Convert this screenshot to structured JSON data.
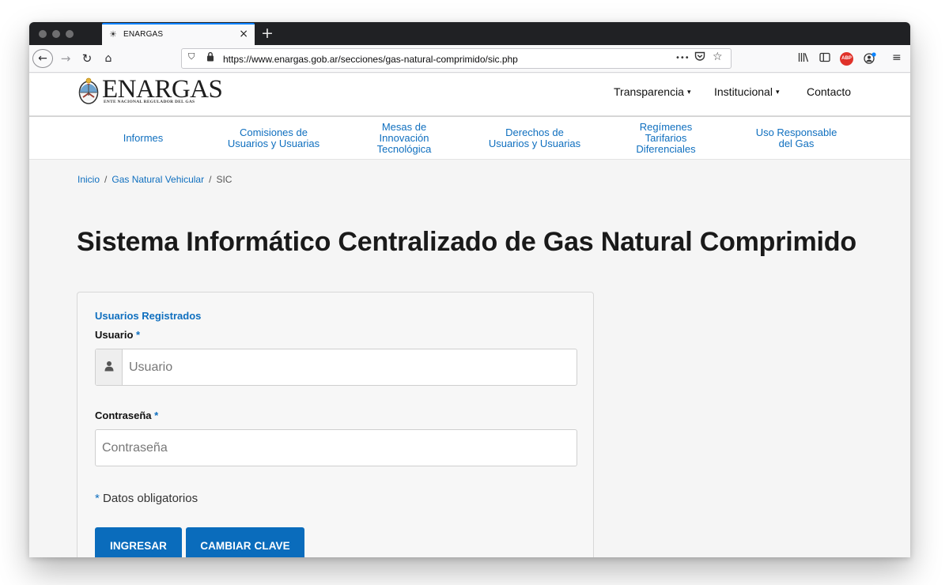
{
  "browser": {
    "tab": {
      "title": "ENARGAS",
      "close": "×"
    },
    "new_tab": "+",
    "url": "https://www.enargas.gob.ar/secciones/gas-natural-comprimido/sic.php",
    "url_more": "•••",
    "addon_badge": "ABP"
  },
  "site": {
    "logo": {
      "name": "ENARGAS",
      "subtitle": "ENTE NACIONAL REGULADOR DEL GAS"
    },
    "topnav": [
      {
        "label": "Transparencia",
        "caret": "▾"
      },
      {
        "label": "Institucional",
        "caret": "▾"
      },
      {
        "label": "Contacto"
      }
    ],
    "menu": [
      {
        "lines": [
          "Informes"
        ]
      },
      {
        "lines": [
          "Comisiones de",
          "Usuarios y Usuarias"
        ]
      },
      {
        "lines": [
          "Mesas de",
          "Innovación",
          "Tecnológica"
        ]
      },
      {
        "lines": [
          "Derechos de",
          "Usuarios y Usuarias"
        ]
      },
      {
        "lines": [
          "Regímenes",
          "Tarifarios",
          "Diferenciales"
        ]
      },
      {
        "lines": [
          "Uso Responsable",
          "del Gas"
        ]
      }
    ]
  },
  "breadcrumb": {
    "home": "Inicio",
    "section": "Gas Natural Vehicular",
    "current": "SIC",
    "separator": "/"
  },
  "page_title": "Sistema Informático Centralizado de Gas Natural Comprimido",
  "login": {
    "heading": "Usuarios Registrados",
    "user_label": "Usuario",
    "user_placeholder": "Usuario",
    "password_label": "Contraseña",
    "password_placeholder": "Contraseña",
    "required_mark": "*",
    "required_note": "Datos obligatorios",
    "submit_label": "INGRESAR",
    "change_password_label": "CAMBIAR CLAVE"
  }
}
